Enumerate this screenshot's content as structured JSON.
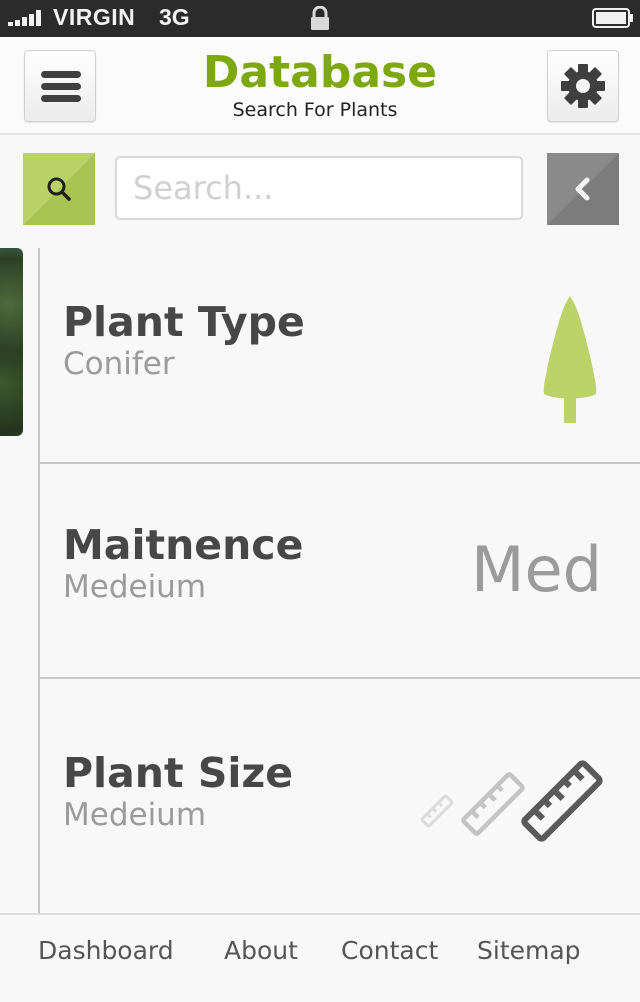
{
  "status_bar": {
    "carrier": "VIRGIN",
    "network": "3G",
    "signal_bars": 5,
    "lock_icon": "lock-icon",
    "battery_icon": "battery-icon"
  },
  "header": {
    "title": "Database",
    "subtitle": "Search For Plants",
    "menu_icon": "hamburger-icon",
    "settings_icon": "gear-icon"
  },
  "search": {
    "placeholder": "Search...",
    "value": "",
    "search_icon": "search-icon",
    "back_icon": "chevron-left-icon"
  },
  "rows": [
    {
      "title": "Plant Type",
      "value": "Conifer",
      "indicator_icon": "conifer-tree-icon"
    },
    {
      "title": "Maitnence",
      "value": "Medeium",
      "indicator_text": "Med"
    },
    {
      "title": "Plant Size",
      "value": "Medeium",
      "indicator_icon": "ruler-size-icons",
      "selected_size_index": 2
    }
  ],
  "footer": {
    "links": [
      "Dashboard",
      "About",
      "Contact",
      "Sitemap"
    ]
  },
  "colors": {
    "brand_green": "#7ea80f",
    "accent_green": "#b9d267",
    "tree_green": "#bcd36a",
    "back_button_gray": "#858585",
    "status_bar_bg": "#2b2b2b"
  }
}
